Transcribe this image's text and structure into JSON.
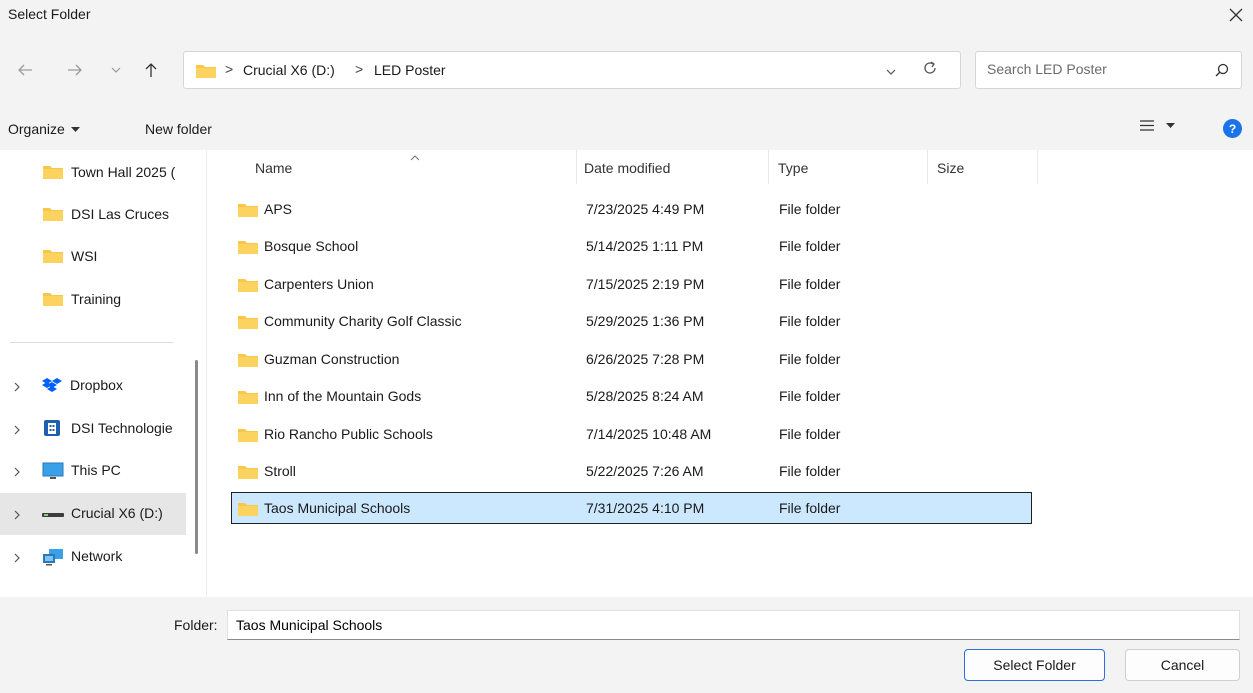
{
  "window": {
    "title": "Select Folder"
  },
  "address": {
    "crumbs": [
      "Crucial X6 (D:)",
      "LED Poster"
    ],
    "separator": ">"
  },
  "search": {
    "placeholder": "Search LED Poster"
  },
  "toolbar": {
    "organize_label": "Organize",
    "new_folder_label": "New folder"
  },
  "sidebar": {
    "quick_items": [
      {
        "label": "Town Hall 2025 (",
        "icon": "folder-icon"
      },
      {
        "label": "DSI Las Cruces",
        "icon": "folder-icon"
      },
      {
        "label": "WSI",
        "icon": "folder-icon"
      },
      {
        "label": "Training",
        "icon": "folder-icon"
      }
    ],
    "locations": [
      {
        "label": "Dropbox",
        "icon": "dropbox-icon"
      },
      {
        "label": "DSI Technologie",
        "icon": "building-icon"
      },
      {
        "label": "This PC",
        "icon": "monitor-icon"
      },
      {
        "label": "Crucial X6 (D:)",
        "icon": "drive-icon",
        "selected": true
      },
      {
        "label": "Network",
        "icon": "network-icon"
      }
    ]
  },
  "columns": {
    "name": "Name",
    "date": "Date modified",
    "type": "Type",
    "size": "Size"
  },
  "files": [
    {
      "name": "APS",
      "date": "7/23/2025 4:49 PM",
      "type": "File folder"
    },
    {
      "name": "Bosque School",
      "date": "5/14/2025 1:11 PM",
      "type": "File folder"
    },
    {
      "name": "Carpenters Union",
      "date": "7/15/2025 2:19 PM",
      "type": "File folder"
    },
    {
      "name": "Community Charity Golf Classic",
      "date": "5/29/2025 1:36 PM",
      "type": "File folder"
    },
    {
      "name": "Guzman Construction",
      "date": "6/26/2025 7:28 PM",
      "type": "File folder"
    },
    {
      "name": "Inn of the Mountain Gods",
      "date": "5/28/2025 8:24 AM",
      "type": "File folder"
    },
    {
      "name": "Rio Rancho Public Schools",
      "date": "7/14/2025 10:48 AM",
      "type": "File folder"
    },
    {
      "name": "Stroll",
      "date": "5/22/2025 7:26 AM",
      "type": "File folder"
    },
    {
      "name": "Taos Municipal Schools",
      "date": "7/31/2025 4:10 PM",
      "type": "File folder",
      "selected": true
    }
  ],
  "footer": {
    "folder_label": "Folder:",
    "folder_value": "Taos Municipal Schools",
    "select_label": "Select Folder",
    "cancel_label": "Cancel"
  },
  "colors": {
    "folder": "#f8c74a",
    "selection": "#cce8ff",
    "accent": "#1a73e8"
  }
}
